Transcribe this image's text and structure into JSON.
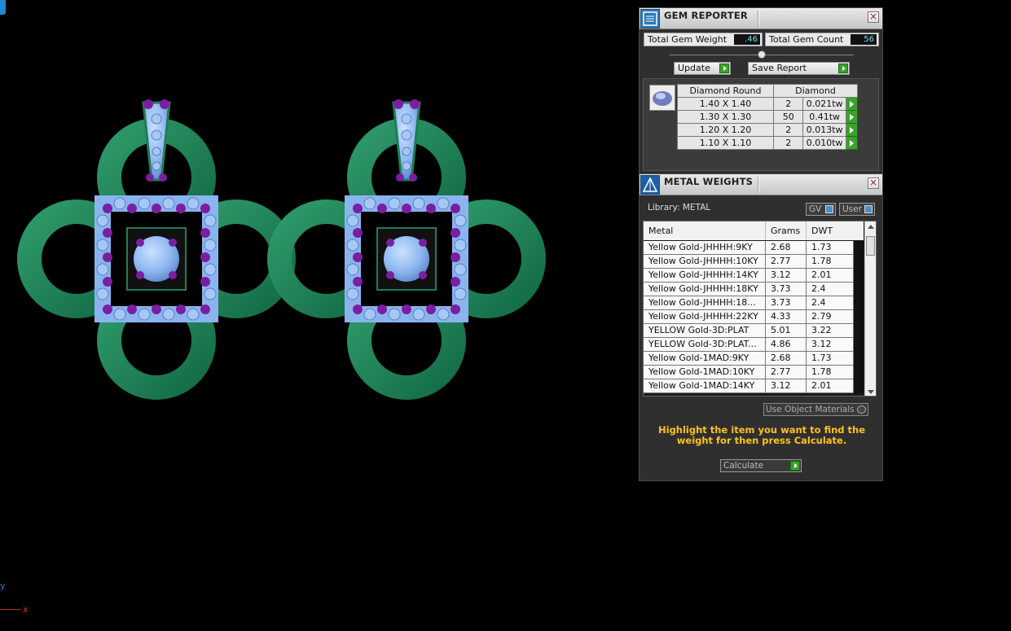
{
  "viewport": {
    "axis_y_label": "y",
    "axis_x_label": "x"
  },
  "gem_reporter": {
    "title": "GEM REPORTER",
    "total_weight_label": "Total Gem Weight",
    "total_weight_value": ".46",
    "total_count_label": "Total Gem Count",
    "total_count_value": "56",
    "update_label": "Update",
    "save_report_label": "Save Report",
    "columns": [
      "Diamond Round",
      "Diamond"
    ],
    "rows": [
      {
        "size": "1.40 X 1.40",
        "count": "2",
        "weight": "0.021tw"
      },
      {
        "size": "1.30 X 1.30",
        "count": "50",
        "weight": "0.41tw"
      },
      {
        "size": "1.20 X 1.20",
        "count": "2",
        "weight": "0.013tw"
      },
      {
        "size": "1.10 X 1.10",
        "count": "2",
        "weight": "0.010tw"
      }
    ]
  },
  "metal_weights": {
    "title": "METAL WEIGHTS",
    "library_label": "Library: METAL",
    "gv_label": "GV",
    "user_label": "User",
    "columns": [
      "Metal",
      "Grams",
      "DWT"
    ],
    "rows": [
      {
        "metal": "Yellow Gold-JHHHH:9KY",
        "grams": "2.68",
        "dwt": "1.73"
      },
      {
        "metal": "Yellow Gold-JHHHH:10KY",
        "grams": "2.77",
        "dwt": "1.78"
      },
      {
        "metal": "Yellow Gold-JHHHH:14KY",
        "grams": "3.12",
        "dwt": "2.01"
      },
      {
        "metal": "Yellow Gold-JHHHH:18KY",
        "grams": "3.73",
        "dwt": "2.4"
      },
      {
        "metal": "Yellow Gold-JHHHH:18...",
        "grams": "3.73",
        "dwt": "2.4"
      },
      {
        "metal": "Yellow Gold-JHHHH:22KY",
        "grams": "4.33",
        "dwt": "2.79"
      },
      {
        "metal": "YELLOW Gold-3D:PLAT",
        "grams": "5.01",
        "dwt": "3.22"
      },
      {
        "metal": "YELLOW Gold-3D:PLAT...",
        "grams": "4.86",
        "dwt": "3.12"
      },
      {
        "metal": "Yellow Gold-1MAD:9KY",
        "grams": "2.68",
        "dwt": "1.73"
      },
      {
        "metal": "Yellow Gold-1MAD:10KY",
        "grams": "2.77",
        "dwt": "1.78"
      },
      {
        "metal": "Yellow Gold-1MAD:14KY",
        "grams": "3.12",
        "dwt": "2.01"
      }
    ],
    "use_object_materials_label": "Use Object Materials",
    "hint": "Highlight the item you want to find the weight for then press Calculate.",
    "calculate_label": "Calculate"
  }
}
